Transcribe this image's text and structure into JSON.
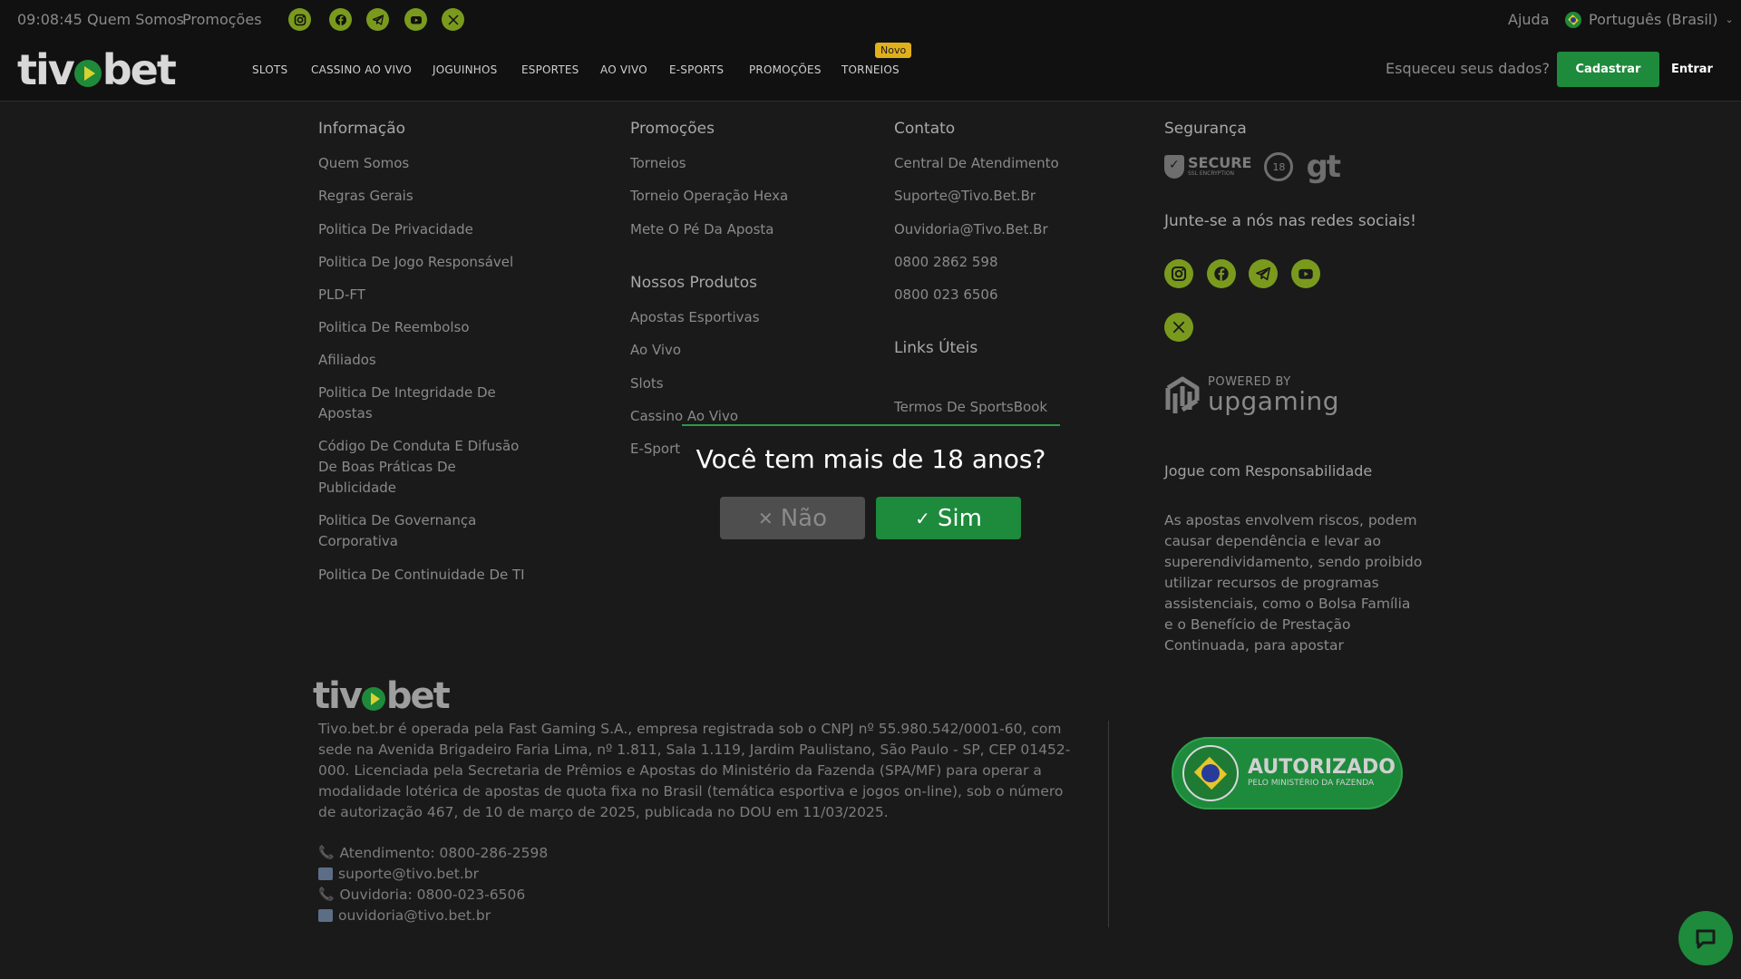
{
  "topbar": {
    "clock": "09:08:45",
    "links": [
      "Quem Somos",
      "Promoções"
    ],
    "help": "Ajuda",
    "language": "Português (Brasil)"
  },
  "nav": {
    "logo": "tivobet",
    "items": [
      "SLOTS",
      "CASSINO AO VIVO",
      "JOGUINHOS",
      "ESPORTES",
      "AO VIVO",
      "E-SPORTS",
      "PROMOÇÕES",
      "TORNEIOS"
    ],
    "badge_novo": "Novo",
    "forgot": "Esqueceu seus dados?",
    "register": "Cadastrar",
    "login": "Entrar"
  },
  "footer": {
    "informacao": {
      "title": "Informação",
      "links": [
        "Quem Somos",
        "Regras Gerais",
        "Politica De Privacidade",
        "Politica De Jogo Responsável",
        "PLD-FT",
        "Politica De Reembolso",
        "Afiliados",
        "Politica De Integridade De",
        "Apostas",
        "Código De Conduta E Difusão",
        "De Boas Práticas De",
        "Publicidade",
        "Politica De Governança",
        "Corporativa",
        "Politica De Continuidade De TI"
      ]
    },
    "promocoes": {
      "title": "Promoções",
      "links": [
        "Torneios",
        "Torneio Operação Hexa",
        "Mete O Pé Da Aposta"
      ]
    },
    "produtos": {
      "title": "Nossos Produtos",
      "links": [
        "Apostas Esportivas",
        "Ao Vivo",
        "Slots",
        "Cassino Ao Vivo",
        "E-Sport"
      ]
    },
    "contato": {
      "title": "Contato",
      "links": [
        "Central De Atendimento",
        "Suporte@Tivo.Bet.Br",
        "Ouvidoria@Tivo.Bet.Br",
        "0800 2862 598",
        "0800 023 6506"
      ]
    },
    "uteis": {
      "title": "Links Úteis",
      "links": [
        "Termos De SportsBook"
      ]
    },
    "seguranca": {
      "title": "Segurança",
      "secure": "SECURE",
      "secure_sub": "SSL ENCRYPTION",
      "age": "18",
      "gt": "gt",
      "social_title": "Junte-se a nós nas redes sociais!"
    },
    "upgaming": {
      "powered": "POWERED BY",
      "name": "upgaming"
    },
    "responsible": {
      "title": "Jogue com Responsabilidade",
      "text": "As apostas envolvem riscos, podem causar dependência e levar ao superendividamento, sendo proibido utilizar recursos de programas assistenciais, como o Bolsa Família e o Benefício de Prestação Continuada, para apostar"
    },
    "legal": "Tivo.bet.br é operada pela Fast Gaming S.A., empresa registrada sob o CNPJ nº 55.980.542/0001-60, com sede na Avenida Brigadeiro Faria Lima, nº 1.811, Sala 1.119, Jardim Paulistano, São Paulo - SP, CEP 01452-000. Licenciada pela Secretaria de Prêmios e Apostas do Ministério da Fazenda (SPA/MF) para operar a modalidade lotérica de apostas de quota fixa no Brasil (temática esportiva e jogos on-line), sob o número de autorização 467, de 10 de março de 2025, publicada no DOU em 11/03/2025.",
    "contacts": [
      "Atendimento: 0800-286-2598",
      "suporte@tivo.bet.br",
      "Ouvidoria: 0800-023-6506",
      "ouvidoria@tivo.bet.br"
    ],
    "autorizado": {
      "title": "AUTORIZADO",
      "subtitle": "PELO MINISTÉRIO DA FAZENDA"
    }
  },
  "modal": {
    "question": "Você tem mais de 18 anos?",
    "no": "Não",
    "yes": "Sim"
  },
  "colors": {
    "brand_green": "#1e8a3c",
    "icon_green": "#7a9a1e",
    "badge": "#e0b01c"
  }
}
